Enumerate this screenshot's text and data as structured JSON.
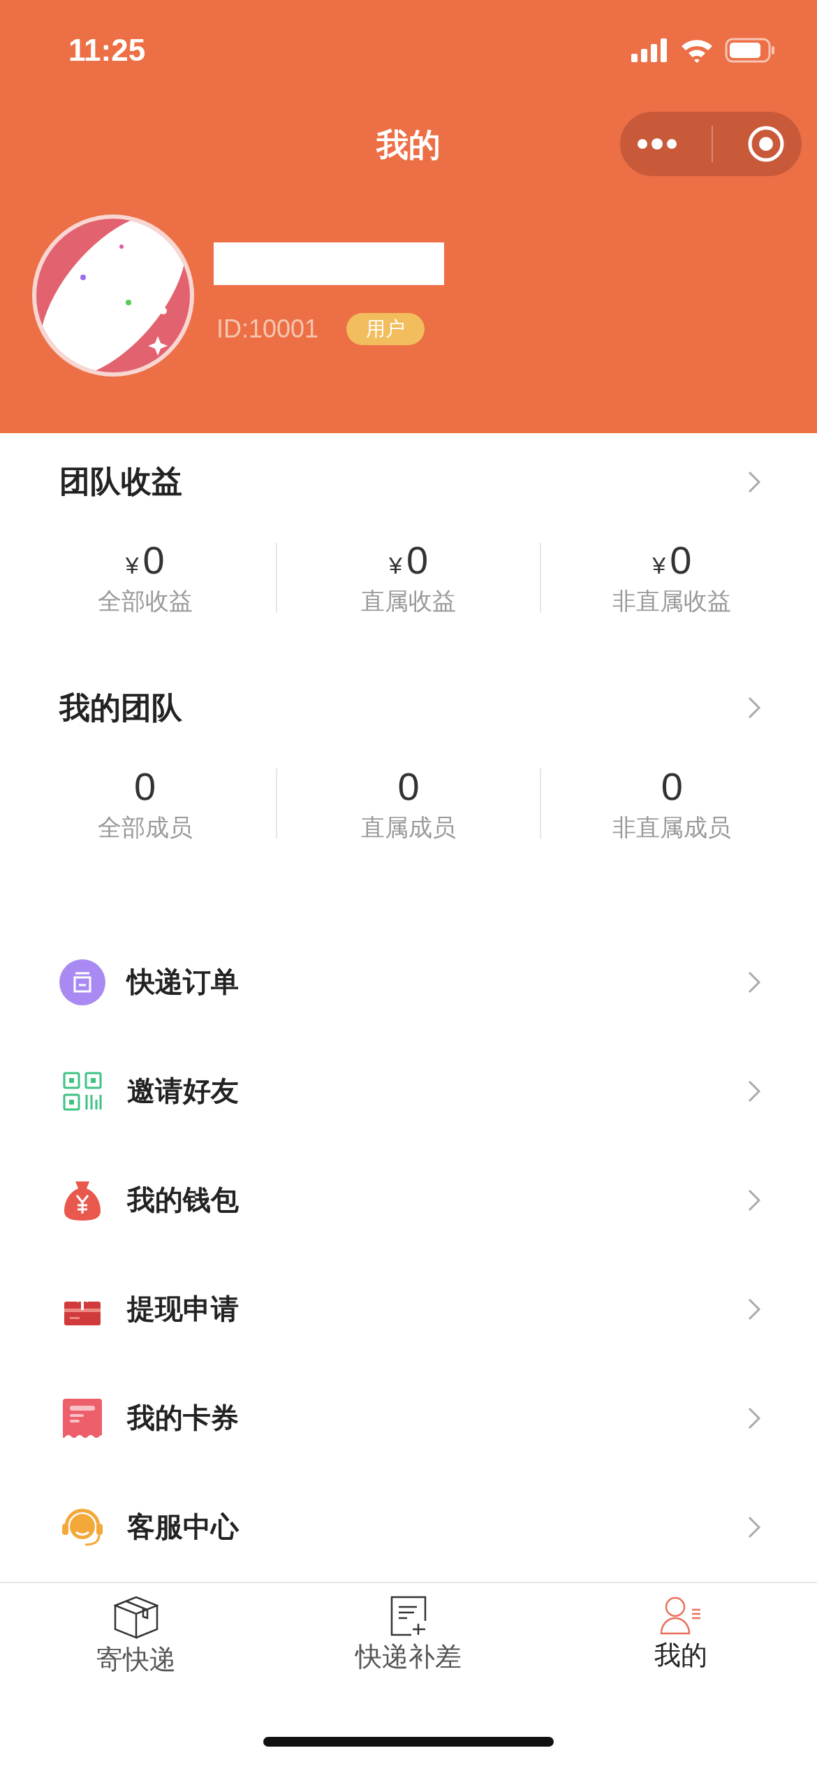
{
  "status_bar": {
    "time": "11:25"
  },
  "nav": {
    "title": "我的"
  },
  "profile": {
    "id_text": "ID:10001",
    "badge": "用户"
  },
  "earnings": {
    "title": "团队收益",
    "stats": [
      {
        "currency": "¥",
        "amount": "0",
        "label": "全部收益"
      },
      {
        "currency": "¥",
        "amount": "0",
        "label": "直属收益"
      },
      {
        "currency": "¥",
        "amount": "0",
        "label": "非直属收益"
      }
    ]
  },
  "team": {
    "title": "我的团队",
    "stats": [
      {
        "amount": "0",
        "label": "全部成员"
      },
      {
        "amount": "0",
        "label": "直属成员"
      },
      {
        "amount": "0",
        "label": "非直属成员"
      }
    ]
  },
  "menu": [
    {
      "kind": "order",
      "label": "快递订单"
    },
    {
      "kind": "qr",
      "label": "邀请好友"
    },
    {
      "kind": "wallet",
      "label": "我的钱包"
    },
    {
      "kind": "withdraw",
      "label": "提现申请"
    },
    {
      "kind": "coupon",
      "label": "我的卡券"
    },
    {
      "kind": "service",
      "label": "客服中心"
    }
  ],
  "tabs": [
    {
      "kind": "box",
      "label": "寄快递",
      "selected": false
    },
    {
      "kind": "note",
      "label": "快递补差",
      "selected": false
    },
    {
      "kind": "user",
      "label": "我的",
      "selected": true
    }
  ]
}
